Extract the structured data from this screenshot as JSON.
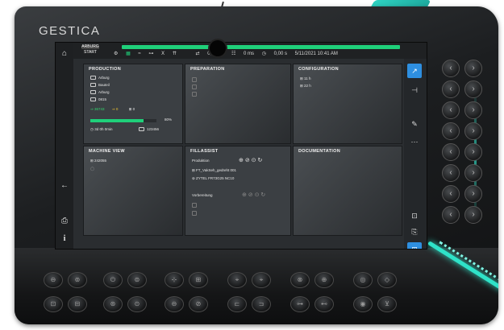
{
  "brand": "GESTICA",
  "topbar": {
    "start_label": "START",
    "start_logo": "ARBURG",
    "icons": [
      "⚙",
      "▦",
      "≈",
      "⊶",
      "ⵝ",
      "⇈",
      "⇄",
      "0,0 cm³",
      "☷",
      "0 ms",
      "◷",
      "0,00 s",
      "5/11/2021 10:41 AM"
    ]
  },
  "left_nav": [
    {
      "name": "home-icon",
      "glyph": "⌂"
    },
    {
      "name": "back-arrow-icon",
      "glyph": "←"
    },
    {
      "name": "printer-icon",
      "glyph": "⎙"
    },
    {
      "name": "info-icon",
      "glyph": "i"
    }
  ],
  "production": {
    "title": "PRODUCTION",
    "rows": [
      "Arburg",
      "Bauteil",
      "Arburg",
      "0815"
    ],
    "counter_green": "36743",
    "counter_yellow": "0",
    "counter_white": "0",
    "progress_fraction": 0.8,
    "progress_label": "80%",
    "time": "3d 0h 0min",
    "order": "123456"
  },
  "preparation": {
    "title": "PREPARATION"
  },
  "configuration": {
    "title": "CONFIGURATION",
    "rows": [
      "11 h",
      "22 h"
    ]
  },
  "machine_view": {
    "title": "MACHINE VIEW",
    "id": "242055"
  },
  "fillassist": {
    "title": "FILLASSIST",
    "label_production": "Produktion",
    "file": "FT_VakSeh_gedreht 001",
    "material": "ZYTEL FR73G25 NC10",
    "label_preparation": "Vorbereitung"
  },
  "documentation": {
    "title": "DOCUMENTATION"
  },
  "right_rail": [
    "↗",
    "⊣",
    "✎",
    "⋯",
    "⊡",
    "⎘",
    "⊞"
  ],
  "colors": {
    "accent_green": "#1fd07a",
    "accent_teal": "#2fe2c8",
    "accent_blue": "#2e8fe0",
    "counter_yellow": "#f0c430"
  },
  "bottom_keys_row1": [
    "⊖",
    "⊚",
    "⏻",
    "⊜",
    "⊹",
    "⊞",
    "⌖",
    "⌖",
    "⊗",
    "⊕",
    "◎",
    "◇"
  ],
  "bottom_keys_row2": [
    "⊡",
    "⊟",
    "⊛",
    "⊙",
    "⊖",
    "⊘",
    "⊏",
    "⊐",
    "⊶",
    "⊷",
    "◉",
    "⊻"
  ]
}
